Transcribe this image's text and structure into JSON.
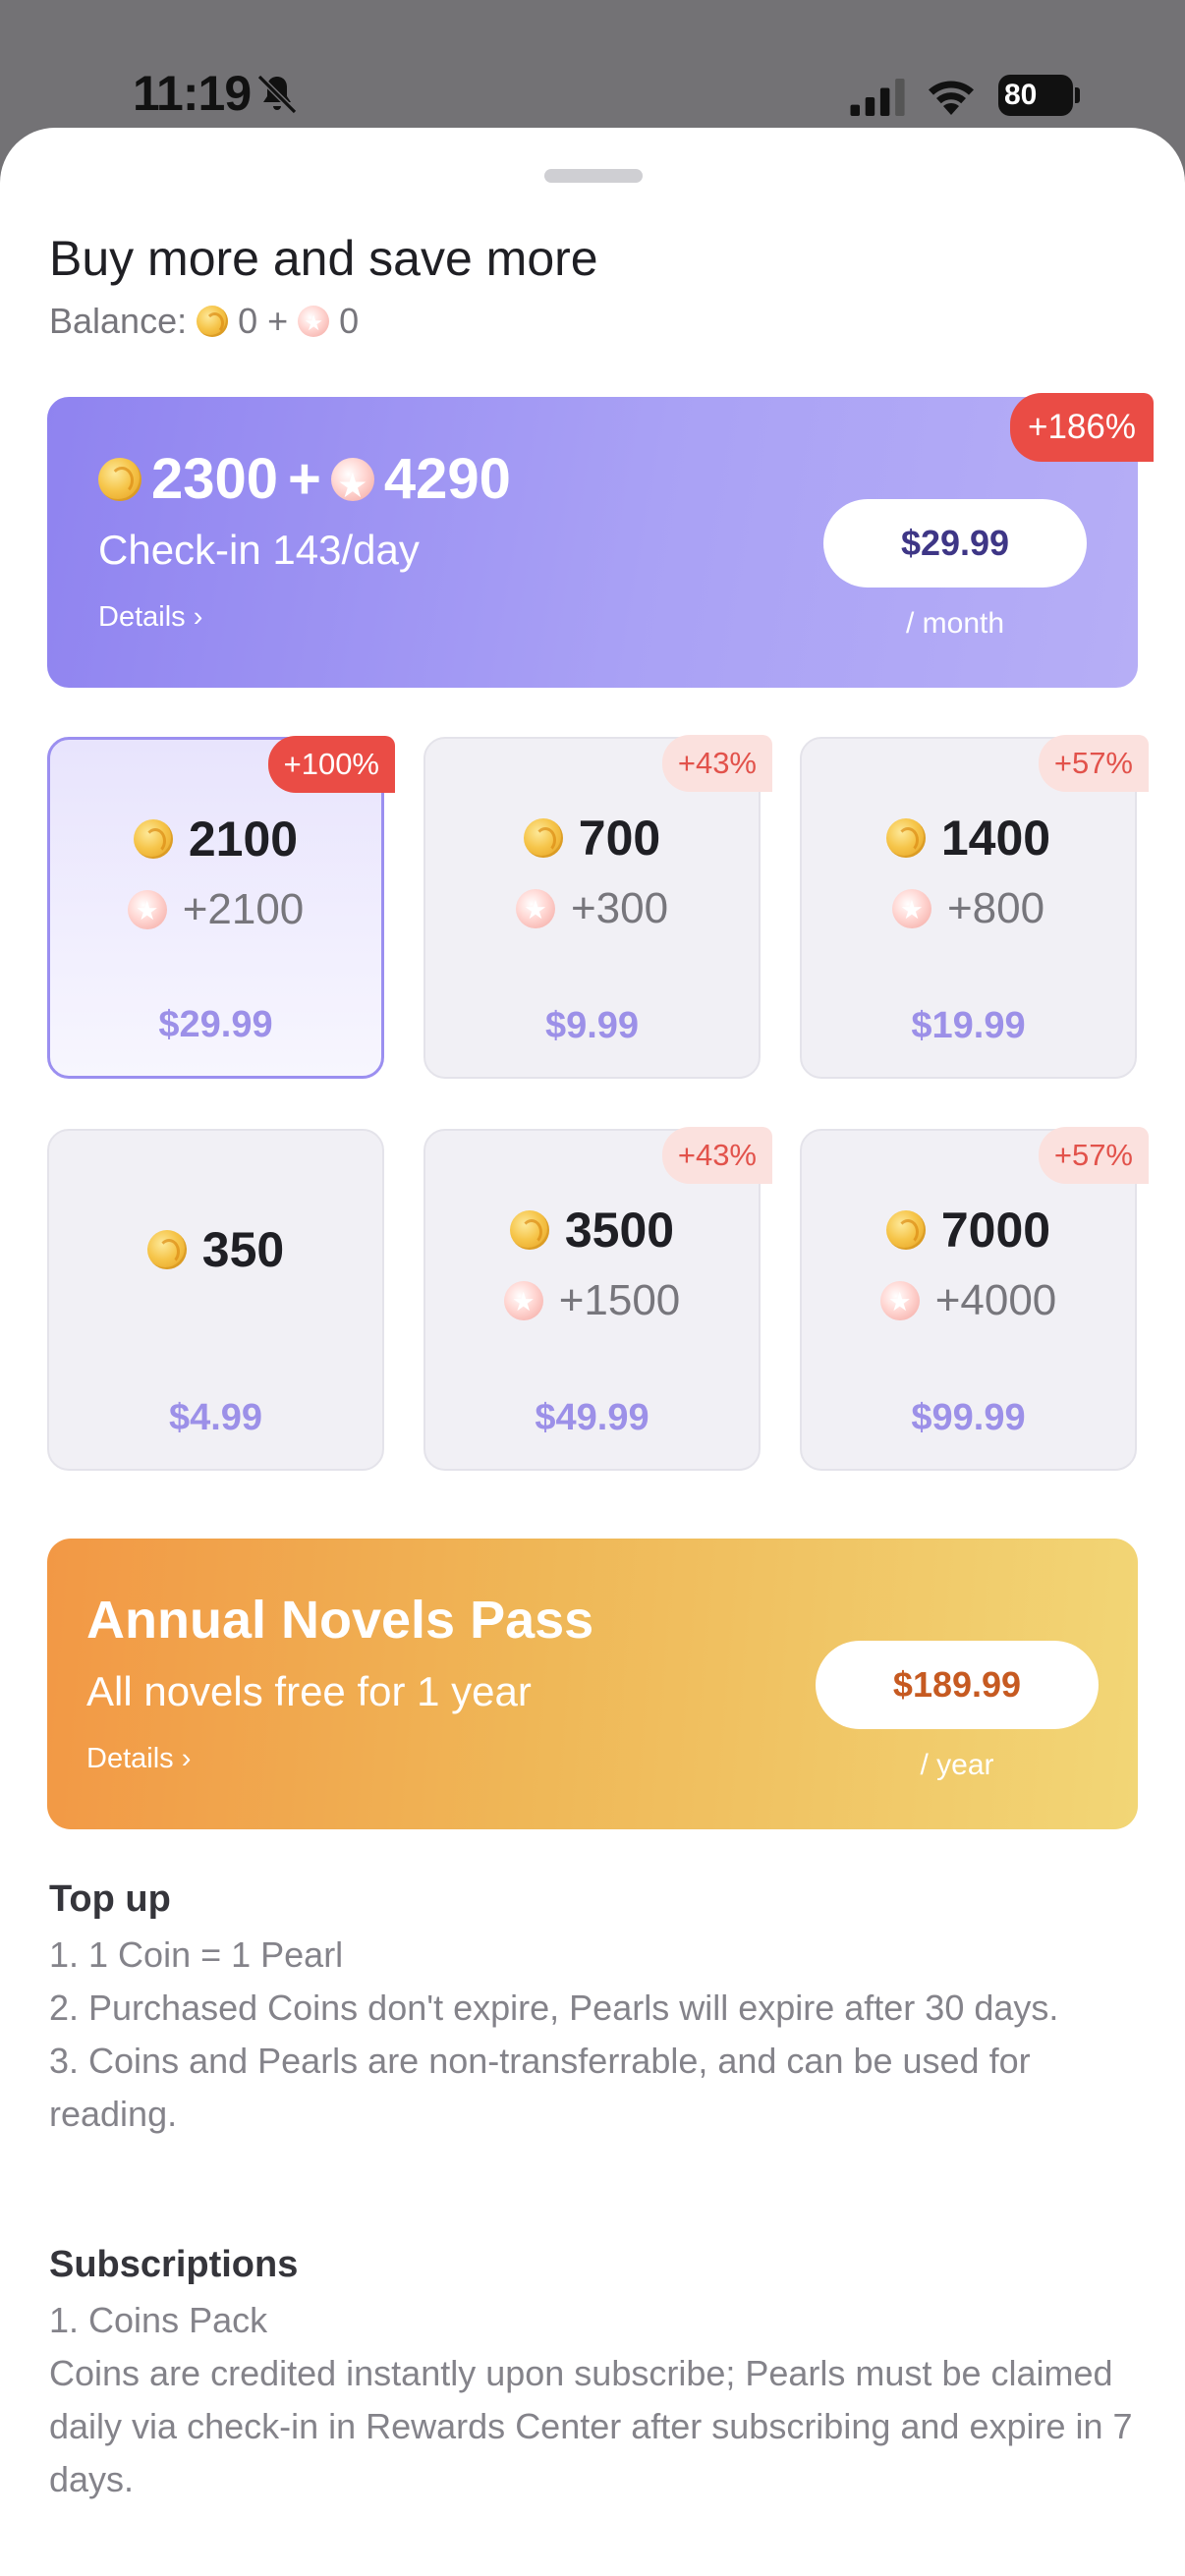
{
  "status_bar": {
    "time": "11:19",
    "battery": "80"
  },
  "sheet": {
    "title": "Buy more and save more",
    "balance": {
      "label": "Balance:",
      "coins": "0",
      "plus": "+",
      "pearls": "0"
    }
  },
  "subscription": {
    "coins": "2300",
    "plus": "+",
    "pearls": "4290",
    "subtitle": "Check-in 143/day",
    "details": "Details",
    "price": "$29.99",
    "period": "/ month",
    "badge": "+186%"
  },
  "packages": [
    {
      "coins": "2100",
      "bonus": "+2100",
      "price": "$29.99",
      "badge": "+100%",
      "selected": true
    },
    {
      "coins": "700",
      "bonus": "+300",
      "price": "$9.99",
      "badge": "+43%"
    },
    {
      "coins": "1400",
      "bonus": "+800",
      "price": "$19.99",
      "badge": "+57%"
    },
    {
      "coins": "350",
      "bonus": "",
      "price": "$4.99",
      "badge": ""
    },
    {
      "coins": "3500",
      "bonus": "+1500",
      "price": "$49.99",
      "badge": "+43%"
    },
    {
      "coins": "7000",
      "bonus": "+4000",
      "price": "$99.99",
      "badge": "+57%"
    }
  ],
  "annual": {
    "title": "Annual Novels Pass",
    "subtitle": "All novels free for 1 year",
    "details": "Details",
    "price": "$189.99",
    "period": "/ year"
  },
  "top_up": {
    "heading": "Top up",
    "lines": [
      "1. 1 Coin = 1 Pearl",
      "2. Purchased Coins don't expire, Pearls will expire after 30 days.",
      "3. Coins and Pearls are non-transferrable, and can be used for reading."
    ]
  },
  "subscriptions": {
    "heading": "Subscriptions",
    "lines": [
      "1. Coins Pack",
      "Coins are credited instantly upon subscribe; Pearls must be claimed daily via check-in in Rewards Center after subscribing and expire in 7 days."
    ]
  },
  "colors": {
    "accent_purple": "#9b8ff0",
    "badge_red": "#ea4c45",
    "annual_orange": "#f29845",
    "price_purple": "#9c90e8"
  }
}
